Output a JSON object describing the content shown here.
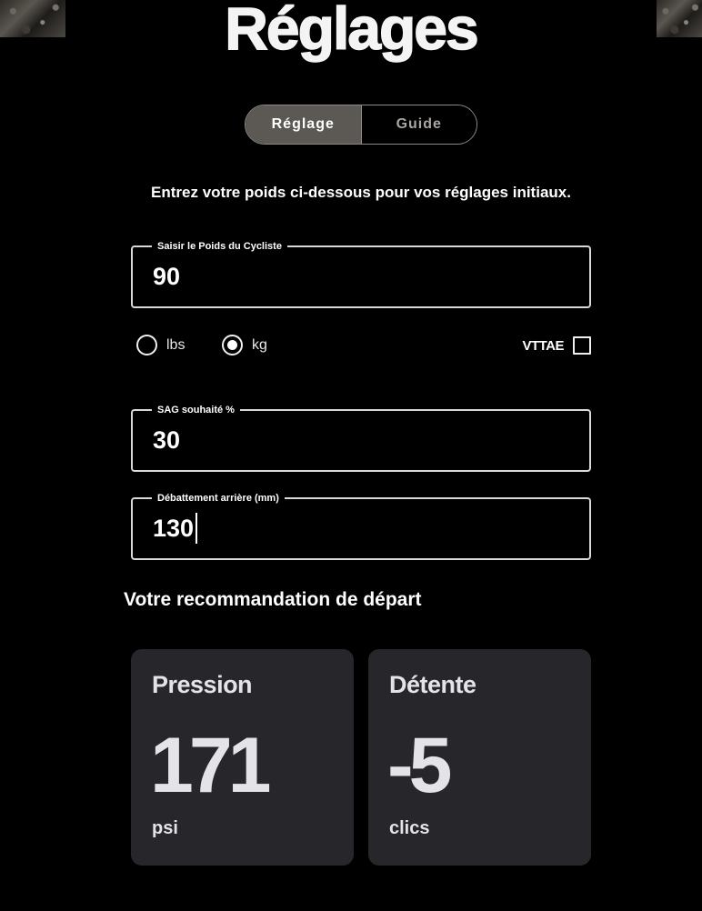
{
  "header": {
    "title": "Réglages"
  },
  "tabs": [
    {
      "label": "Réglage",
      "active": true
    },
    {
      "label": "Guide",
      "active": false
    }
  ],
  "intro": "Entrez votre poids ci-dessous pour vos réglages initiaux.",
  "weight_field": {
    "label": "Saisir le Poids du Cycliste",
    "value": "90"
  },
  "units": {
    "options": [
      {
        "label": "lbs",
        "selected": false
      },
      {
        "label": "kg",
        "selected": true
      }
    ]
  },
  "ebike": {
    "label": "VTTAE",
    "checked": false
  },
  "sag_field": {
    "label": "SAG souhaité %",
    "value": "30"
  },
  "travel_field": {
    "label": "Débattement arrière (mm)",
    "value": "130"
  },
  "recommendation": {
    "title": "Votre recommandation de départ",
    "cards": [
      {
        "title": "Pression",
        "value": "171",
        "unit": "psi"
      },
      {
        "title": "Détente",
        "value": "-5",
        "unit": "clics"
      }
    ]
  },
  "colors": {
    "background": "#000000",
    "card_background": "#27262a",
    "tab_active": "#5c5954",
    "text": "#ffffff"
  }
}
